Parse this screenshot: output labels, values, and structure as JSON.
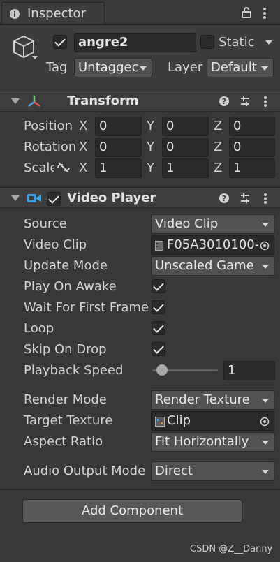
{
  "window": {
    "tab_title": "Inspector",
    "lock_icon": "lock-icon",
    "menu_icon": "kebab-menu-icon"
  },
  "gameobject": {
    "icon": "cube-icon",
    "active": true,
    "name": "angre2",
    "static_label": "Static",
    "static": false,
    "tag_label": "Tag",
    "tag_value": "Untaggec",
    "layer_label": "Layer",
    "layer_value": "Default"
  },
  "transform": {
    "title": "Transform",
    "rows": [
      {
        "label": "Position",
        "x": "0",
        "y": "0",
        "z": "0"
      },
      {
        "label": "Rotation",
        "x": "0",
        "y": "0",
        "z": "0"
      },
      {
        "label": "Scale",
        "x": "1",
        "y": "1",
        "z": "1"
      }
    ],
    "axis": {
      "x": "X",
      "y": "Y",
      "z": "Z"
    }
  },
  "video_player": {
    "title": "Video Player",
    "enabled": true,
    "source_label": "Source",
    "source_value": "Video Clip",
    "clip_label": "Video Clip",
    "clip_value": "F05A3010100-",
    "update_label": "Update Mode",
    "update_value": "Unscaled Game",
    "play_on_awake_label": "Play On Awake",
    "wait_first_frame_label": "Wait For First Frame",
    "loop_label": "Loop",
    "skip_on_drop_label": "Skip On Drop",
    "play_on_awake": true,
    "wait_first_frame": true,
    "loop": true,
    "skip_on_drop": true,
    "speed_label": "Playback Speed",
    "speed_value": "1",
    "speed_slider_fraction": 0.0,
    "render_mode_label": "Render Mode",
    "render_mode_value": "Render Texture",
    "target_texture_label": "Target Texture",
    "target_texture_value": "Clip",
    "aspect_label": "Aspect Ratio",
    "aspect_value": "Fit Horizontally",
    "audio_label": "Audio Output Mode",
    "audio_value": "Direct"
  },
  "add_component_label": "Add Component",
  "watermark": "CSDN @Z__Danny"
}
